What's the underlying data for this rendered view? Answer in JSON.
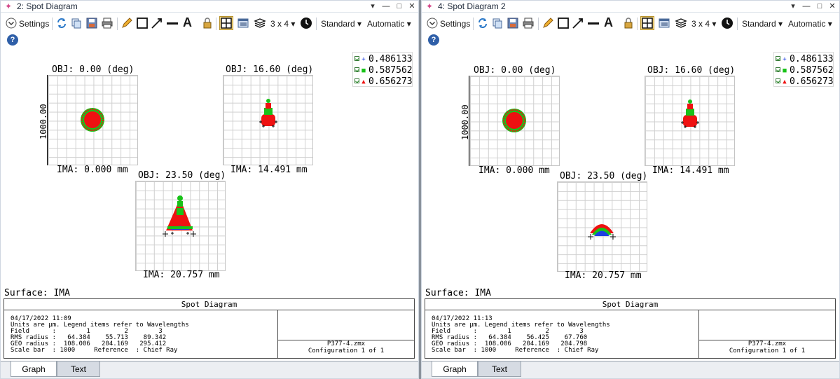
{
  "panes": [
    {
      "title": "2: Spot Diagram",
      "toolbar": {
        "settings": "Settings",
        "layout": "3 x 4",
        "standard": "Standard",
        "automatic": "Automatic"
      },
      "legend": [
        "0.486133",
        "0.587562",
        "0.656273"
      ],
      "fields": [
        {
          "obj": "OBJ: 0.00 (deg)",
          "ima": "IMA: 0.000 mm"
        },
        {
          "obj": "OBJ: 16.60 (deg)",
          "ima": "IMA: 14.491 mm"
        },
        {
          "obj": "OBJ: 23.50 (deg)",
          "ima": "IMA: 20.757 mm"
        }
      ],
      "scale_label": "1000.00",
      "surface": "Surface: IMA",
      "info_title": "Spot Diagram",
      "info_text": "04/17/2022 11:09\nUnits are µm. Legend items refer to Wavelengths\nField      :        1         2        3\nRMS radius :   64.384    55.713    89.342\nGEO radius :  108.006   204.169   295.412\nScale bar  : 1000     Reference  : Chief Ray",
      "file": "P377-4.zmx",
      "config": "Configuration 1 of 1",
      "tabs": [
        "Graph",
        "Text"
      ]
    },
    {
      "title": "4: Spot Diagram 2",
      "toolbar": {
        "settings": "Settings",
        "layout": "3 x 4",
        "standard": "Standard",
        "automatic": "Automatic"
      },
      "legend": [
        "0.486133",
        "0.587562",
        "0.656273"
      ],
      "fields": [
        {
          "obj": "OBJ: 0.00 (deg)",
          "ima": "IMA: 0.000 mm"
        },
        {
          "obj": "OBJ: 16.60 (deg)",
          "ima": "IMA: 14.491 mm"
        },
        {
          "obj": "OBJ: 23.50 (deg)",
          "ima": "IMA: 20.757 mm"
        }
      ],
      "scale_label": "1000.00",
      "surface": "Surface: IMA",
      "info_title": "Spot Diagram",
      "info_text": "04/17/2022 11:13\nUnits are µm. Legend items refer to Wavelengths\nField      :        1         2        3\nRMS radius :   64.384    56.425    67.760\nGEO radius :  108.006   204.169   204.798\nScale bar  : 1000     Reference  : Chief Ray",
      "file": "P377-4.zmx",
      "config": "Configuration 1 of 1",
      "tabs": [
        "Graph",
        "Text"
      ]
    }
  ],
  "colors": {
    "wl1": "#1f3fe0",
    "wl2": "#19c219",
    "wl3": "#ee1111",
    "accent": "#2f5fa8"
  },
  "icons": [
    "settings-chevron-icon",
    "refresh-icon",
    "copy-icon",
    "save-icon",
    "print-icon",
    "pencil-icon",
    "rectangle-icon",
    "arrow-icon",
    "line-icon",
    "text-icon",
    "lock-icon",
    "layout-icon",
    "window-icon",
    "layers-icon",
    "clock-icon",
    "help-icon"
  ]
}
